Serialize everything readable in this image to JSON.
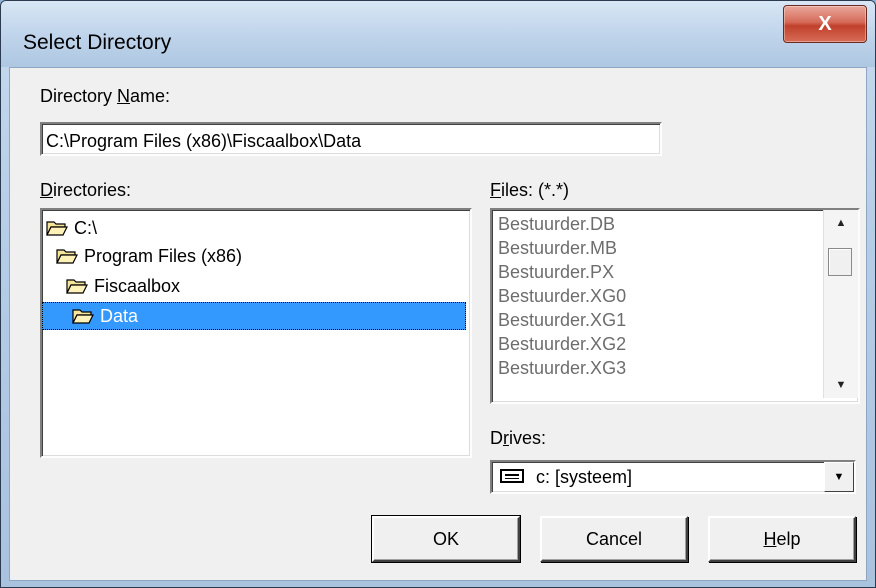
{
  "window": {
    "title": "Select Directory",
    "close_label": "X"
  },
  "directory_name": {
    "label_pre": "Directory ",
    "label_hot": "N",
    "label_post": "ame:",
    "value": "C:\\Program Files (x86)\\Fiscaalbox\\Data"
  },
  "directories": {
    "label_hot": "D",
    "label_post": "irectories:",
    "items": [
      {
        "label": "C:\\",
        "selected": false
      },
      {
        "label": "Program Files (x86)",
        "selected": false
      },
      {
        "label": "Fiscaalbox",
        "selected": false
      },
      {
        "label": "Data",
        "selected": true
      }
    ]
  },
  "files": {
    "label_hot": "F",
    "label_post": "iles: (*.*)",
    "items": [
      "Bestuurder.DB",
      "Bestuurder.MB",
      "Bestuurder.PX",
      "Bestuurder.XG0",
      "Bestuurder.XG1",
      "Bestuurder.XG2",
      "Bestuurder.XG3"
    ]
  },
  "drives": {
    "label_pre": "D",
    "label_hot": "r",
    "label_post": "ives:",
    "selected": "c: [systeem]"
  },
  "buttons": {
    "ok": "OK",
    "cancel": "Cancel",
    "help_hot": "H",
    "help_post": "elp"
  },
  "colors": {
    "selection": "#3399ff",
    "close_button": "#c7503c",
    "dialog_face": "#f0f0f0"
  }
}
